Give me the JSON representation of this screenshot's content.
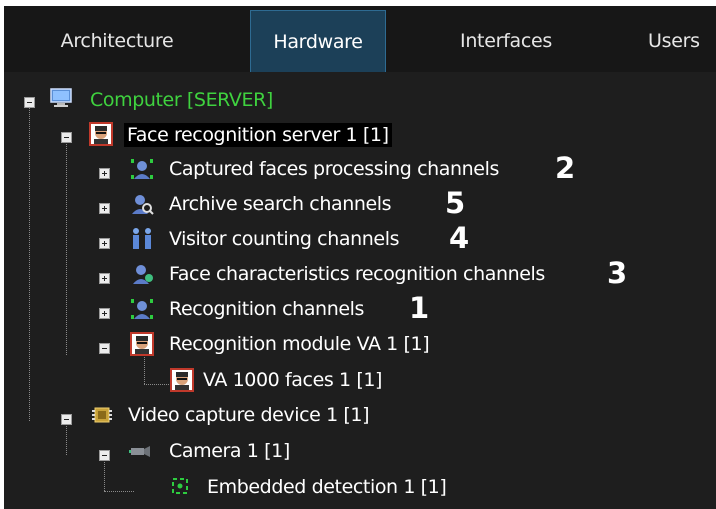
{
  "tabs": [
    {
      "label": "Architecture",
      "active": false
    },
    {
      "label": "Hardware",
      "active": true
    },
    {
      "label": "Interfaces",
      "active": false
    },
    {
      "label": "Users",
      "active": false
    }
  ],
  "tree": {
    "computer": "Computer [SERVER]",
    "face_server": "Face recognition server 1 [1]",
    "captured_faces": "Captured faces processing channels",
    "archive_search": "Archive search channels",
    "visitor_counting": "Visitor counting channels",
    "face_characteristics": "Face characteristics recognition channels",
    "recognition_channels": "Recognition channels",
    "recognition_module": "Recognition module VA 1 [1]",
    "va_faces": "VA 1000 faces 1 [1]",
    "video_capture": "Video capture device 1 [1]",
    "camera": "Camera 1 [1]",
    "embedded_detection": "Embedded detection 1 [1]"
  },
  "annotations": {
    "captured_faces": "2",
    "archive_search": "5",
    "visitor_counting": "4",
    "face_characteristics": "3",
    "recognition_channels": "1"
  },
  "colors": {
    "background": "#1e1e1e",
    "tabbar": "#171717",
    "active_tab": "#1c4058",
    "computer_label": "#3fd23f"
  }
}
